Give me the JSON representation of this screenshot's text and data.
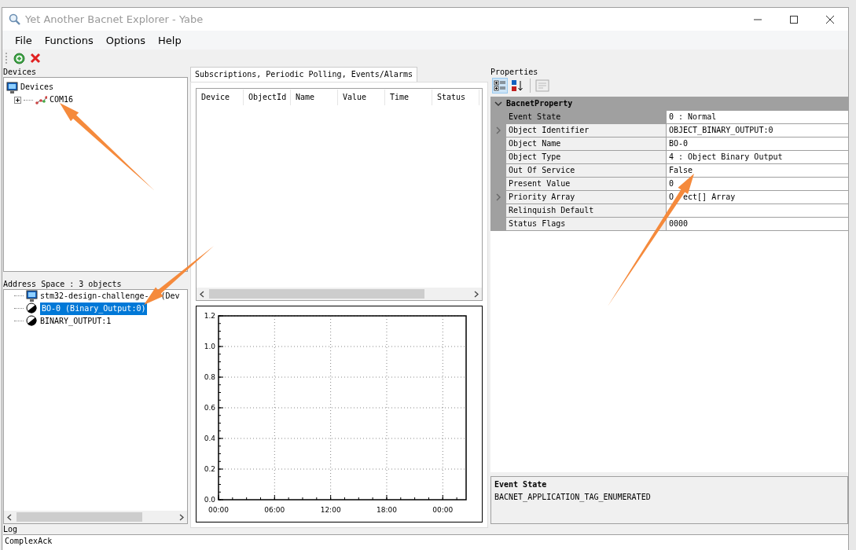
{
  "window": {
    "title": "Yet Another Bacnet Explorer - Yabe"
  },
  "menu": [
    "File",
    "Functions",
    "Options",
    "Help"
  ],
  "devices_panel": {
    "label": "Devices",
    "tree": [
      {
        "label": "Devices",
        "kind": "root",
        "children": [
          {
            "label": "COM16",
            "kind": "port",
            "expanded": false
          }
        ]
      }
    ]
  },
  "address_space": {
    "label": "Address Space : 3 objects",
    "items": [
      {
        "label_parts": [
          "stm32-design-challenge-",
          "(Dev"
        ],
        "kind": "device",
        "selected": false
      },
      {
        "label": "BO-0 (Binary_Output:0)",
        "kind": "binary",
        "selected": true
      },
      {
        "label": "BINARY_OUTPUT:1",
        "kind": "binary",
        "selected": false
      }
    ]
  },
  "tabs": [
    {
      "label": "Subscriptions, Periodic Polling, Events/Alarms",
      "selected": true
    }
  ],
  "subscriptions_table": {
    "columns": [
      "Device",
      "ObjectId",
      "Name",
      "Value",
      "Time",
      "Status"
    ]
  },
  "chart": {
    "chart_data": {
      "type": "line",
      "grid": true,
      "xlim": [
        0,
        26.5
      ],
      "ylim": [
        0,
        1.2
      ],
      "xticks": [
        {
          "value": 0,
          "label": "00:00"
        },
        {
          "value": 6,
          "label": "06:00"
        },
        {
          "value": 12,
          "label": "12:00"
        },
        {
          "value": 18,
          "label": "18:00"
        },
        {
          "value": 24,
          "label": "00:00"
        }
      ],
      "yticks": [
        {
          "value": 0,
          "label": "0.0"
        },
        {
          "value": 0.2,
          "label": "0.2"
        },
        {
          "value": 0.4,
          "label": "0.4"
        },
        {
          "value": 0.6,
          "label": "0.6"
        },
        {
          "value": 0.8,
          "label": "0.8"
        },
        {
          "value": 1,
          "label": "1.0"
        },
        {
          "value": 1.2,
          "label": "1.2"
        }
      ]
    }
  },
  "properties": {
    "label": "Properties",
    "sort_buttons": [
      {
        "kind": "categorized",
        "selected": true
      },
      {
        "kind": "alphabetical",
        "selected": false
      }
    ],
    "category": "BacnetProperty",
    "expanded": true,
    "rows": [
      {
        "name": "Event State",
        "value": "0 : Normal",
        "expandable": false
      },
      {
        "name": "Object Identifier",
        "value": "OBJECT_BINARY_OUTPUT:0",
        "expandable": true
      },
      {
        "name": "Object Name",
        "value": "BO-0",
        "expandable": false
      },
      {
        "name": "Object Type",
        "value": "4 : Object Binary Output",
        "expandable": false
      },
      {
        "name": "Out Of Service",
        "value": "False",
        "expandable": false
      },
      {
        "name": "Present Value",
        "value": "0",
        "expandable": false
      },
      {
        "name": "Priority Array",
        "value_parts": [
          "O",
          "ect[] Array"
        ],
        "expandable": true
      },
      {
        "name": "Relinquish Default",
        "expandable": false
      },
      {
        "name": "Status Flags",
        "value": "0000",
        "expandable": false
      }
    ]
  },
  "description": {
    "title": "Event State",
    "text": "BACNET_APPLICATION_TAG_ENUMERATED"
  },
  "log": {
    "label": "Log",
    "lines": [
      "ComplexAck"
    ]
  }
}
